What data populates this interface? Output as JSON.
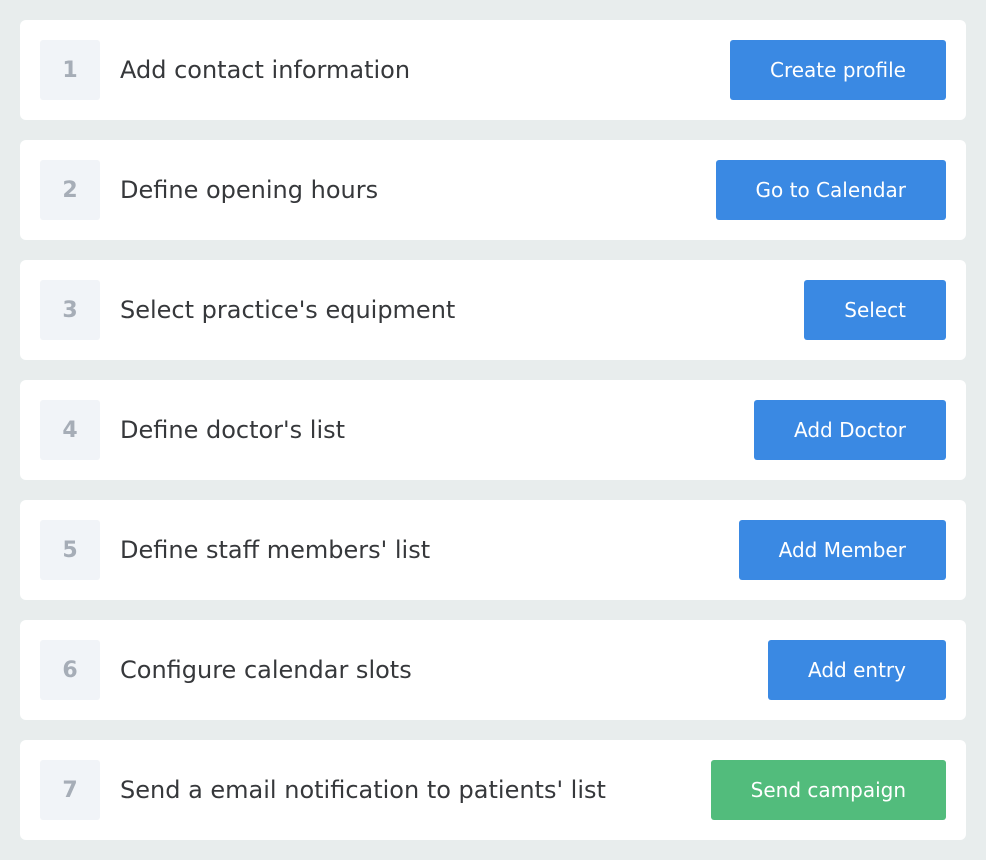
{
  "colors": {
    "background": "#e8eded",
    "card": "#ffffff",
    "number_box": "#f1f4f8",
    "number_text": "#a6adb7",
    "label_text": "#36383b",
    "primary_button": "#3a89e3",
    "success_button": "#52bc7c"
  },
  "steps": [
    {
      "number": "1",
      "label": "Add contact information",
      "button": "Create profile"
    },
    {
      "number": "2",
      "label": "Define opening hours",
      "button": "Go to Calendar"
    },
    {
      "number": "3",
      "label": "Select practice's equipment",
      "button": "Select"
    },
    {
      "number": "4",
      "label": "Define doctor's list",
      "button": "Add Doctor"
    },
    {
      "number": "5",
      "label": "Define staff members' list",
      "button": "Add Member"
    },
    {
      "number": "6",
      "label": "Configure calendar slots",
      "button": "Add entry"
    },
    {
      "number": "7",
      "label": "Send a email notification to patients' list",
      "button": "Send campaign"
    }
  ]
}
